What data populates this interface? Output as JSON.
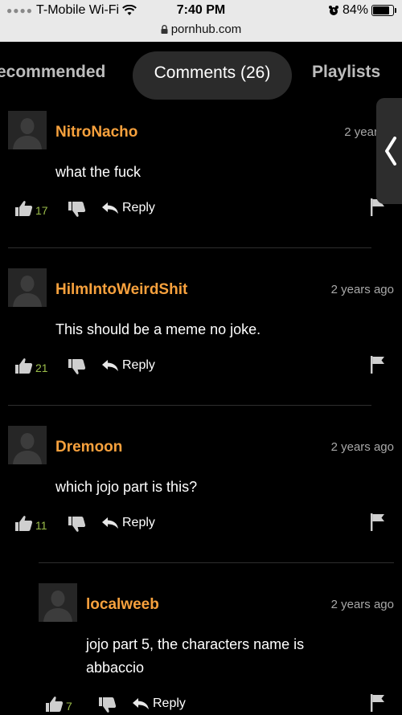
{
  "status_bar": {
    "carrier": "T-Mobile Wi-Fi",
    "time": "7:40 PM",
    "battery": "84%",
    "battery_level": 0.84,
    "url": "pornhub.com"
  },
  "tabs": [
    {
      "label": "ecommended"
    },
    {
      "label": "Comments (26)",
      "active": true
    },
    {
      "label": "Playlists"
    }
  ],
  "comments": [
    {
      "username": "NitroNacho",
      "time": "2 years a",
      "text": [
        "what the fuck"
      ],
      "likes": "17",
      "reply": "Reply"
    },
    {
      "username": "HilmIntoWeirdShit",
      "time": "2 years ago",
      "text": [
        "This should be a meme no joke."
      ],
      "likes": "21",
      "reply": "Reply"
    },
    {
      "username": "Dremoon",
      "time": "2 years ago",
      "text": [
        "which jojo part is this?"
      ],
      "likes": "11",
      "reply": "Reply"
    },
    {
      "username": "localweeb",
      "time": "2 years ago",
      "text": [
        "jojo part 5, the characters name is",
        "abbaccio"
      ],
      "likes": "7",
      "reply": "Reply",
      "nested": true
    }
  ],
  "colors": {
    "username": "#f7a13d",
    "like_count": "#9bbd4a",
    "background": "#000000",
    "active_tab_bg": "#2b2b2b"
  },
  "icons": [
    "wifi-icon",
    "alarm-icon",
    "battery-icon",
    "lock-icon",
    "chevron-left-icon",
    "thumbs-up-icon",
    "thumbs-down-icon",
    "reply-arrow-icon",
    "flag-icon",
    "avatar-silhouette-icon"
  ]
}
